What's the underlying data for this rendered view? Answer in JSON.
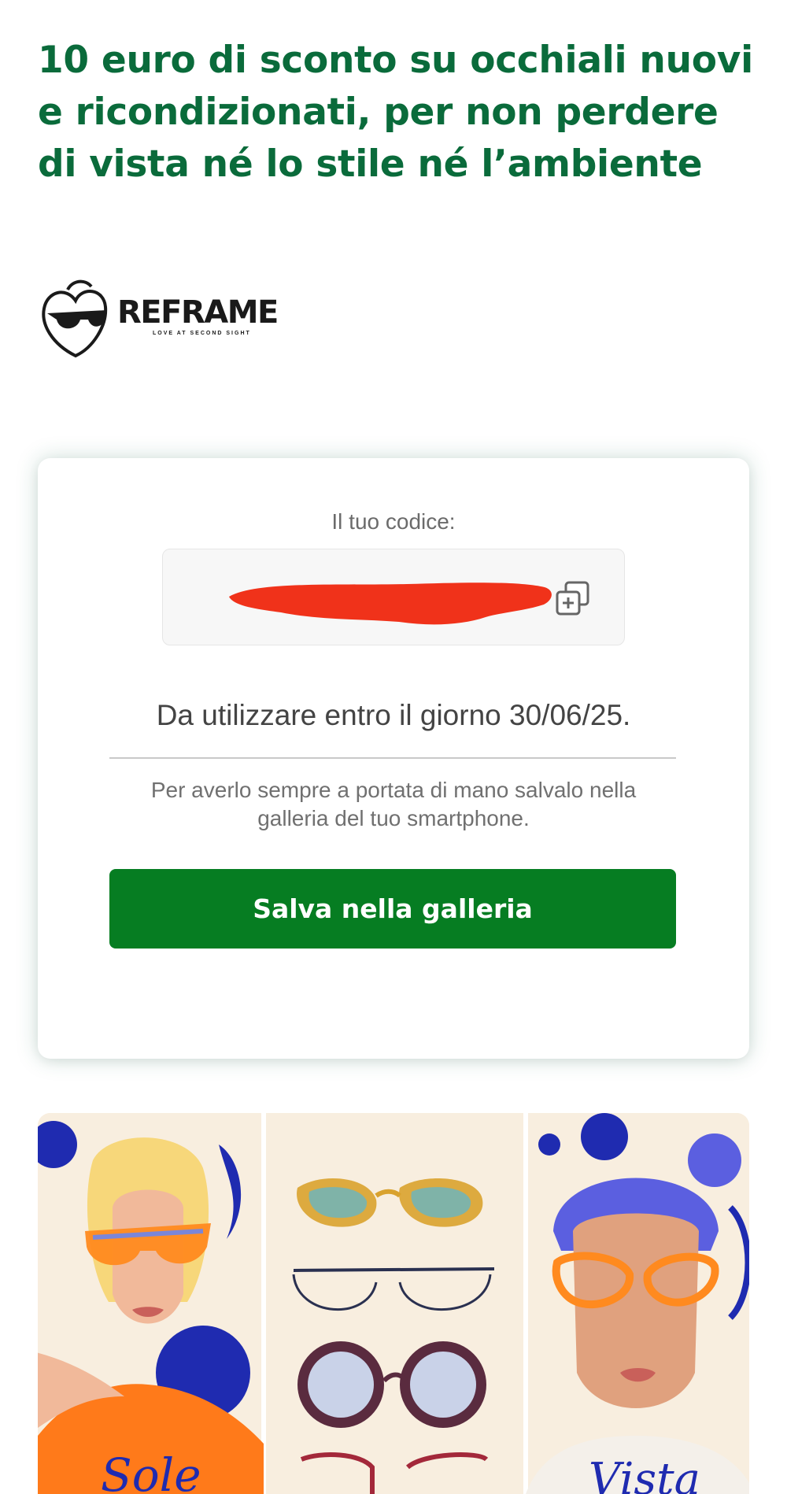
{
  "headline": "10 euro di sconto su occhiali nuovi e ricondizionati, per non perdere di vista né lo stile né l’ambiente",
  "brand": {
    "name": "REFRAME",
    "tagline": "LOVE AT SECOND SIGHT"
  },
  "coupon": {
    "label": "Il tuo codice:",
    "code_redacted": true,
    "copy_icon": "copy-plus-icon",
    "expiry": "Da utilizzare entro il giorno 30/06/25.",
    "hint": "Per averlo sempre a portata di mano salvalo nella galleria del tuo smartphone.",
    "save_button": "Salva nella galleria"
  },
  "banner": {
    "left_word": "Sole",
    "right_word": "Vista"
  },
  "colors": {
    "headline": "#0a6b3b",
    "button": "#067d22",
    "redaction": "#f0321a",
    "banner_accent": "#1f2bb0"
  }
}
